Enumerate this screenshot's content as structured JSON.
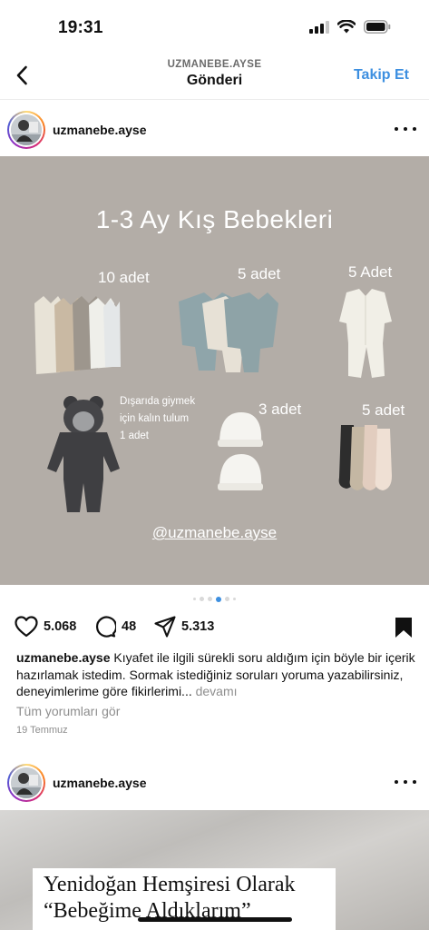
{
  "status_bar": {
    "time": "19:31"
  },
  "nav": {
    "username": "UZMANEBE.AYSE",
    "title": "Gönderi",
    "follow_label": "Takip Et"
  },
  "post": {
    "username": "uzmanebe.ayse",
    "image": {
      "title": "1-3 Ay  Kış Bebekleri",
      "labels": {
        "bodysuits": "10 adet",
        "sets": "5 adet",
        "sleepsuits": "5 Adet",
        "outdoor_note": [
          "Dışarıda giymek",
          "için kalın tulum",
          "1 adet"
        ],
        "hats": "3 adet",
        "socks": "5 adet"
      },
      "handle": "@uzmanebe.ayse"
    },
    "carousel": {
      "count": 6,
      "active_index": 3
    },
    "likes": "5.068",
    "comments": "48",
    "shares": "5.313",
    "caption_user": "uzmanebe.ayse",
    "caption_text": " Kıyafet ile ilgili sürekli soru aldığım için böyle bir içerik hazırlamak istedim. Sormak istediğiniz soruları yoruma yazabilirsiniz, deneyimlerime göre fikirlerimi... ",
    "caption_more": "devamı",
    "view_comments": "Tüm yorumları gör",
    "date": "19 Temmuz"
  },
  "post2": {
    "username": "uzmanebe.ayse",
    "text_line1": "Yenidoğan Hemşiresi Olarak",
    "text_line2": "“Bebeğime Aldıklarım”"
  },
  "colors": {
    "accent": "#3d8fe0",
    "image_bg": "#b3ada7"
  }
}
